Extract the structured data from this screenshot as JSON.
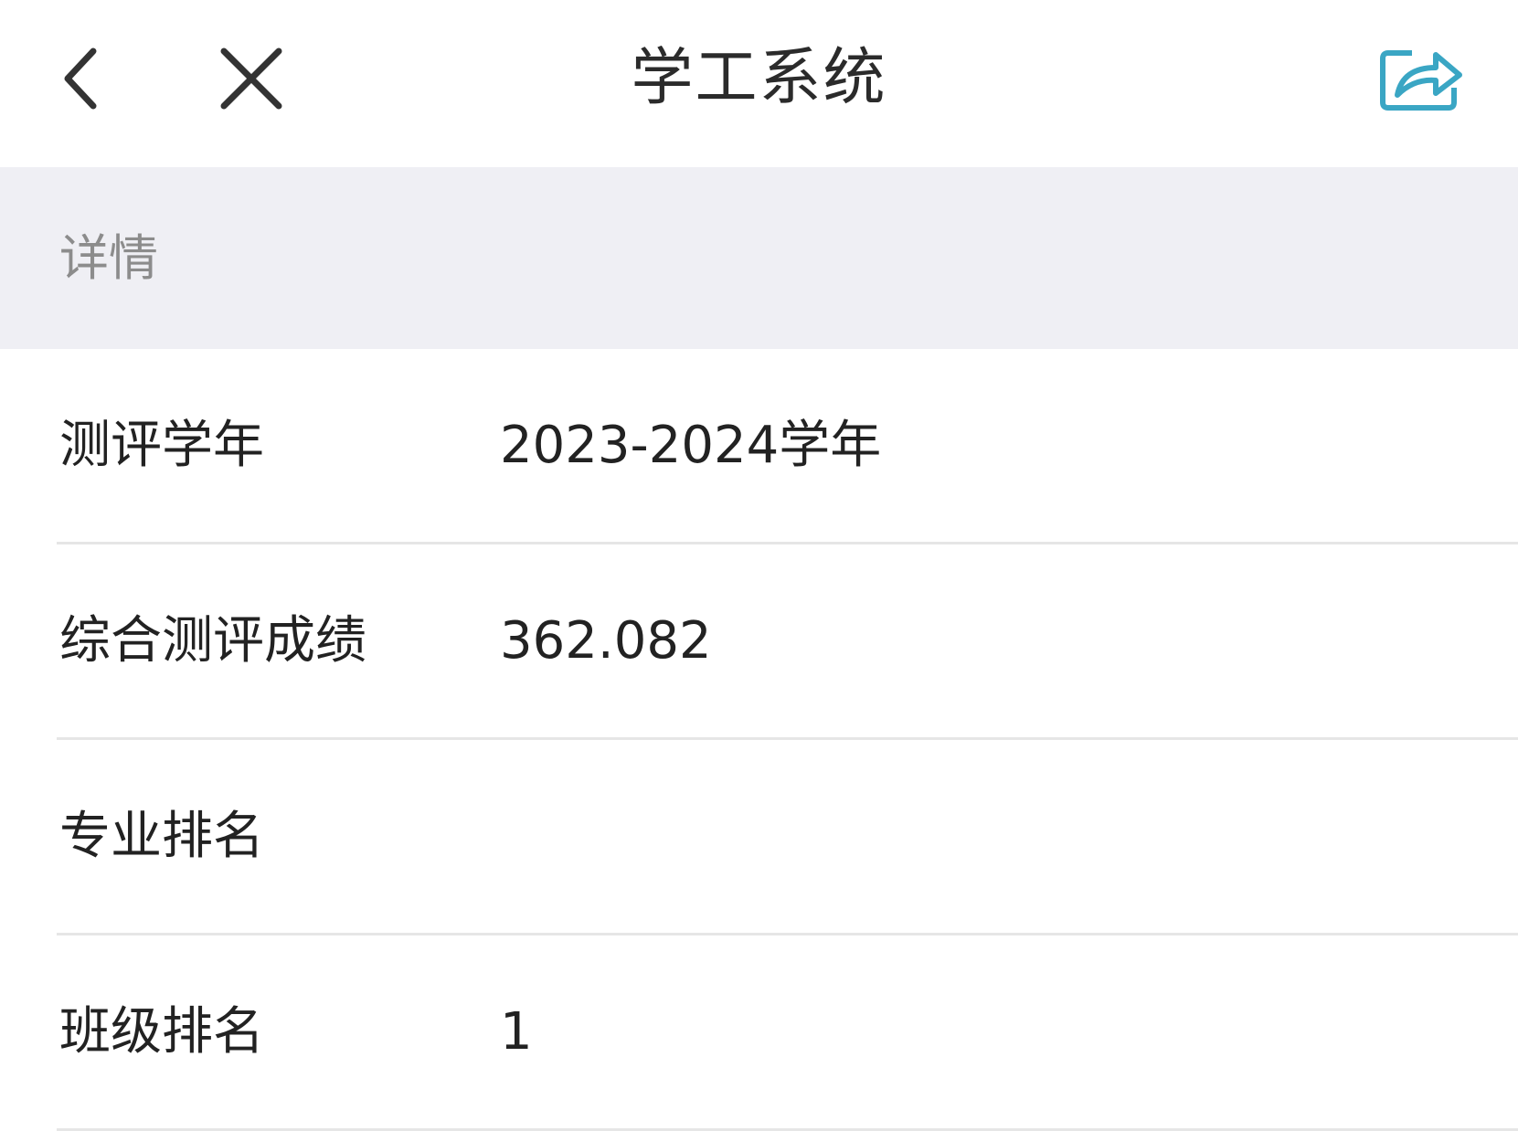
{
  "nav": {
    "title": "学工系统",
    "back_icon": "chevron-left-icon",
    "close_icon": "close-icon",
    "share_icon": "share-icon",
    "share_color": "#3aa6c4"
  },
  "section": {
    "title": "详情"
  },
  "rows": [
    {
      "label": "测评学年",
      "value": "2023-2024学年"
    },
    {
      "label": "综合测评成绩",
      "value": "362.082"
    },
    {
      "label": "专业排名",
      "value": ""
    },
    {
      "label": "班级排名",
      "value": "1"
    }
  ]
}
